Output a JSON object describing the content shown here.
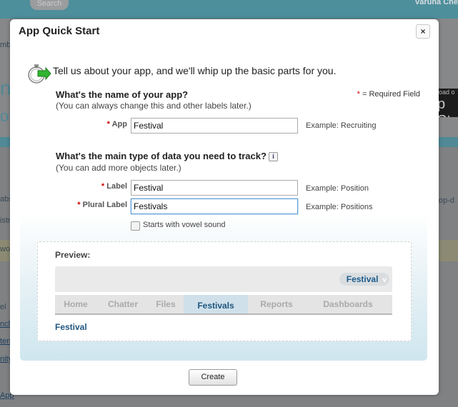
{
  "background": {
    "search_label": "Search",
    "user_name": "Varuna Che",
    "fragments": [
      "mbe",
      "n",
      "ob",
      "abs",
      "istr",
      "wo",
      "el",
      "nch",
      "ten",
      "nity",
      "App",
      "op-d"
    ],
    "badge_small": "load o",
    "badge_big": "p St"
  },
  "dialog": {
    "title": "App Quick Start",
    "close_label": "×",
    "intro": "Tell us about your app, and we'll whip up the basic parts for you.",
    "required_legend_star": "*",
    "required_legend_text": " = Required Field",
    "app_question": "What's the name of your app?",
    "app_question_sub": "(You can always change this and other labels later.)",
    "app_label": "App",
    "app_value": "Festival",
    "app_example": "Example: Recruiting",
    "data_question": "What's the main type of data you need to track?",
    "info_label": "i",
    "data_question_sub": "(You can add more objects later.)",
    "label_label": "Label",
    "label_value": "Festival",
    "label_example": "Example: Position",
    "plural_label": "Plural Label",
    "plural_value": "Festivals",
    "plural_example": "Example: Positions",
    "vowel_label": "Starts with vowel sound",
    "vowel_checked": false,
    "required_star": "*"
  },
  "preview": {
    "title": "Preview:",
    "app_picker": "Festival",
    "app_picker_chevron": "v",
    "tabs": [
      "Home",
      "Chatter",
      "Files",
      "Festivals",
      "Reports",
      "Dashboards"
    ],
    "active_tab": "Festivals",
    "link": "Festival"
  },
  "footer": {
    "create_label": "Create"
  },
  "colors": {
    "accent_blue": "#1f5680",
    "active_tab_bg": "#cfe0ea",
    "required_red": "#cc0000",
    "arrow_green": "#2fb52f"
  }
}
